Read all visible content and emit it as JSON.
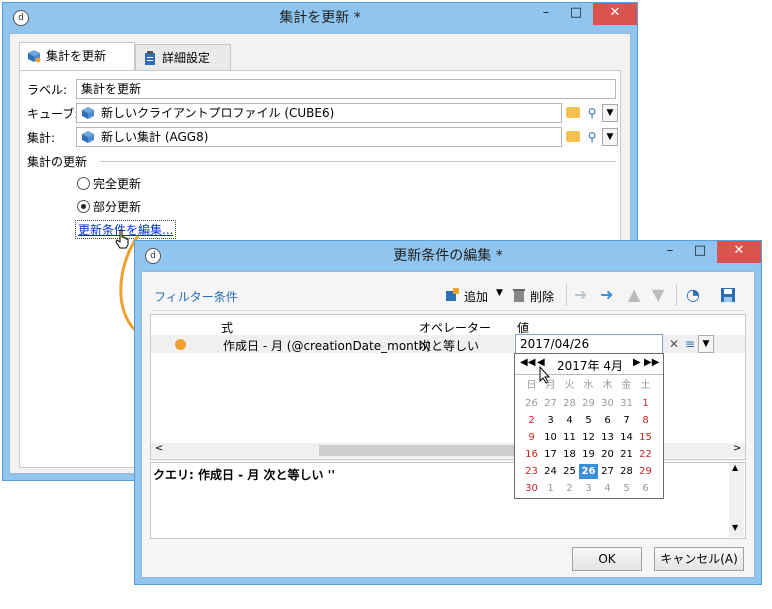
{
  "main_window": {
    "title": "集計を更新 *",
    "tabs": [
      {
        "label": "集計を更新"
      },
      {
        "label": "詳細設定"
      }
    ],
    "label_field": {
      "label": "ラベル:",
      "value": "集計を更新"
    },
    "cube_field": {
      "label": "キューブ:",
      "value": "新しいクライアントプロファイル (CUBE6)"
    },
    "aggregate_field": {
      "label": "集計:",
      "value": "新しい集計 (AGG8)"
    },
    "section_title": "集計の更新",
    "radio_full": "完全更新",
    "radio_partial": "部分更新",
    "edit_link": "更新条件を編集..."
  },
  "dialog": {
    "title": "更新条件の編集 *",
    "toolbar": {
      "filter_label": "フィルター条件",
      "add": "追加",
      "delete": "削除"
    },
    "columns": [
      "式",
      "オペレーター",
      "値"
    ],
    "row": {
      "expression": "作成日 - 月 (@creationDate_month)",
      "operator": "次と等しい",
      "value": "2017/04/26"
    },
    "query": "クエリ: 作成日 - 月 次と等しい ''",
    "ok": "OK",
    "cancel": "キャンセル(A)"
  },
  "calendar": {
    "month_label": "2017年 4月",
    "weekdays": [
      "日",
      "月",
      "火",
      "水",
      "木",
      "金",
      "土"
    ],
    "weeks": [
      [
        "26",
        "27",
        "28",
        "29",
        "30",
        "31",
        "1"
      ],
      [
        "2",
        "3",
        "4",
        "5",
        "6",
        "7",
        "8"
      ],
      [
        "9",
        "10",
        "11",
        "12",
        "13",
        "14",
        "15"
      ],
      [
        "16",
        "17",
        "18",
        "19",
        "20",
        "21",
        "22"
      ],
      [
        "23",
        "24",
        "25",
        "26",
        "27",
        "28",
        "29"
      ],
      [
        "30",
        "1",
        "2",
        "3",
        "4",
        "5",
        "6"
      ]
    ],
    "selected_day": "26"
  },
  "colors": {
    "accent": "#3b8fd9",
    "orange": "#f0a030",
    "sunday": "#cc2222",
    "selected": "#3b8fd9"
  }
}
